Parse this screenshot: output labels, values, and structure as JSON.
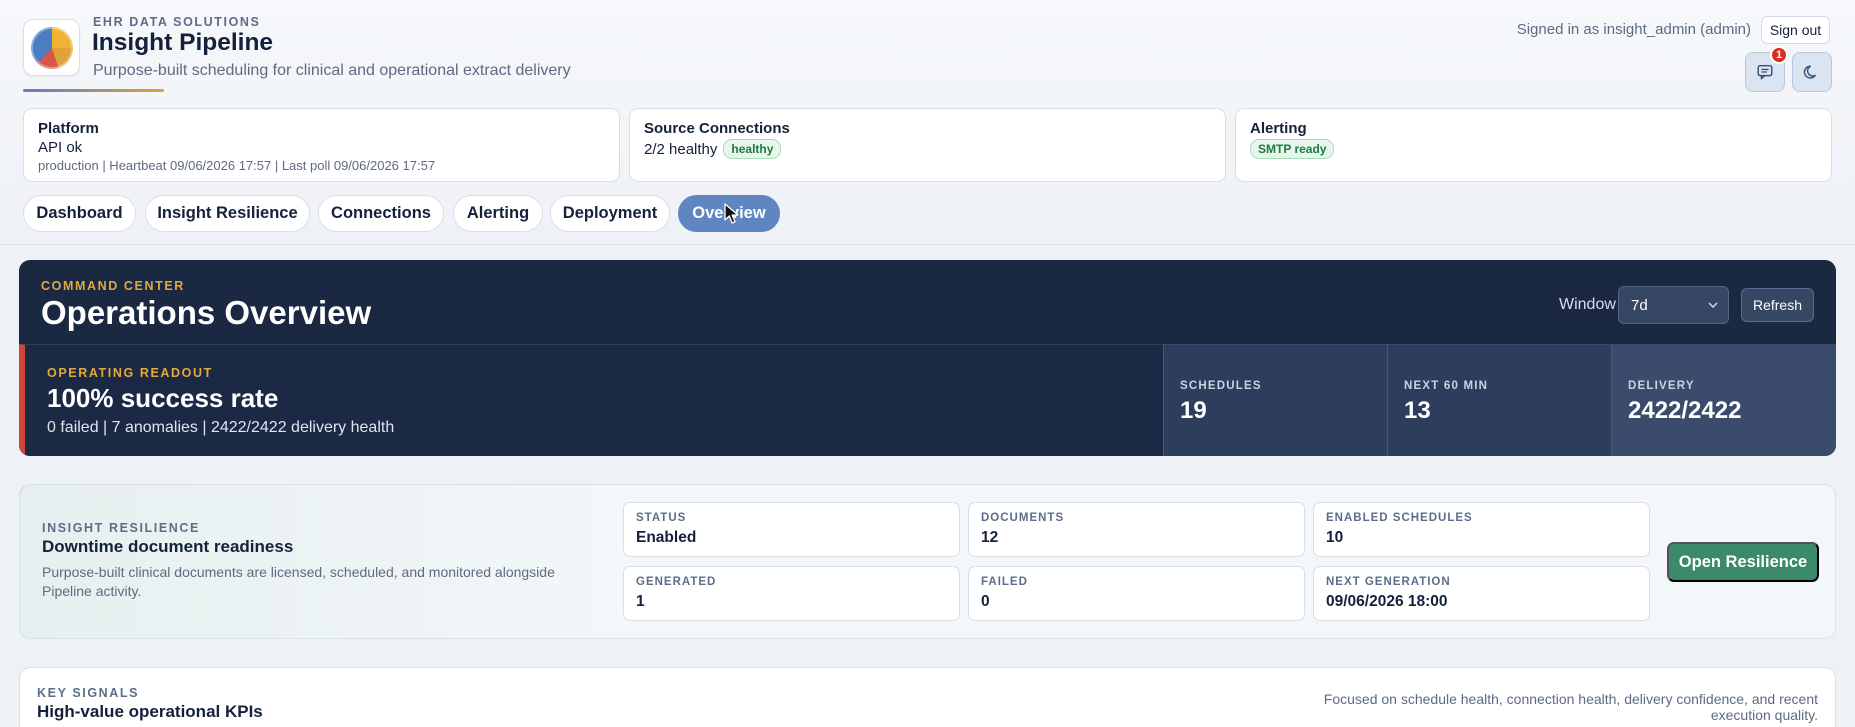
{
  "brand": {
    "kicker": "EHR DATA SOLUTIONS",
    "title": "Insight Pipeline",
    "subtitle": "Purpose-built scheduling for clinical and operational extract delivery"
  },
  "user": {
    "signed_in": "Signed in as insight_admin (admin)",
    "signout_label": "Sign out",
    "notification_count": "1"
  },
  "status_cards": {
    "platform": {
      "title": "Platform",
      "line": "API ok",
      "meta": "production | Heartbeat 09/06/2026 17:57 | Last poll 09/06/2026 17:57"
    },
    "sources": {
      "title": "Source Connections",
      "line": "2/2 healthy",
      "pill": "healthy"
    },
    "alerting": {
      "title": "Alerting",
      "pill": "SMTP ready"
    }
  },
  "tabs": [
    "Dashboard",
    "Insight Resilience",
    "Connections",
    "Alerting",
    "Deployment",
    "Overview"
  ],
  "active_tab": "Overview",
  "command": {
    "kicker": "COMMAND CENTER",
    "title": "Operations Overview",
    "window_label": "Window",
    "window_value": "7d",
    "refresh_label": "Refresh",
    "readout": {
      "kicker": "OPERATING READOUT",
      "title": "100% success rate",
      "sub": "0 failed | 7 anomalies | 2422/2422 delivery health"
    },
    "kpis": [
      {
        "label": "SCHEDULES",
        "value": "19"
      },
      {
        "label": "NEXT 60 MIN",
        "value": "13"
      },
      {
        "label": "DELIVERY",
        "value": "2422/2422"
      }
    ]
  },
  "resilience": {
    "kicker": "INSIGHT RESILIENCE",
    "title": "Downtime document readiness",
    "description": "Purpose-built clinical documents are licensed, scheduled, and monitored alongside Pipeline activity.",
    "stats": [
      {
        "label": "STATUS",
        "value": "Enabled"
      },
      {
        "label": "DOCUMENTS",
        "value": "12"
      },
      {
        "label": "ENABLED SCHEDULES",
        "value": "10"
      },
      {
        "label": "GENERATED",
        "value": "1"
      },
      {
        "label": "FAILED",
        "value": "0"
      },
      {
        "label": "NEXT GENERATION",
        "value": "09/06/2026 18:00"
      }
    ],
    "open_label": "Open Resilience"
  },
  "signals": {
    "kicker": "KEY SIGNALS",
    "title": "High-value operational KPIs",
    "note": "Focused on schedule health, connection health, delivery confidence, and recent execution quality."
  },
  "colors": {
    "accent": "#5f86c0",
    "command_bg": "#1b2842",
    "amber": "#e3a93d",
    "alert_red": "#d0463c",
    "resilience_green": "#3b8a6c"
  }
}
